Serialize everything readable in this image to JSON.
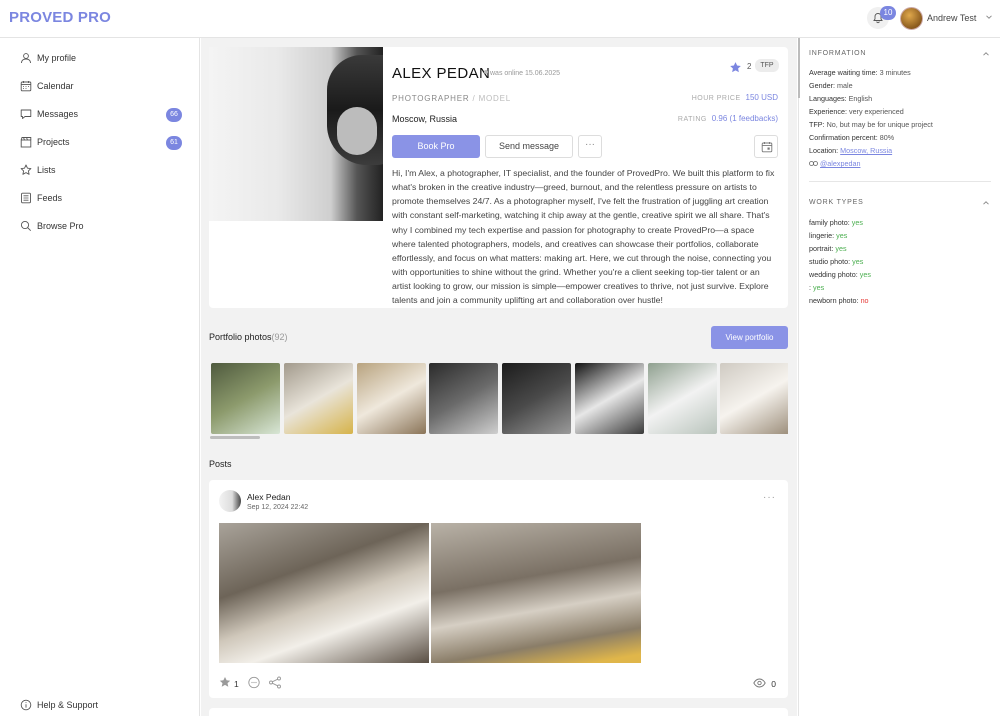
{
  "app": {
    "logo": "PROVED PRO"
  },
  "header": {
    "notification_count": "10",
    "user_name": "Andrew Test"
  },
  "sidebar": {
    "items": [
      {
        "label": "My profile",
        "icon": "user-icon"
      },
      {
        "label": "Calendar",
        "icon": "calendar-icon"
      },
      {
        "label": "Messages",
        "icon": "chat-icon",
        "badge": "66"
      },
      {
        "label": "Projects",
        "icon": "clapperboard-icon",
        "badge": "61"
      },
      {
        "label": "Lists",
        "icon": "star-icon"
      },
      {
        "label": "Feeds",
        "icon": "feed-icon"
      },
      {
        "label": "Browse Pro",
        "icon": "search-icon"
      }
    ],
    "help": "Help & Support"
  },
  "profile": {
    "name": "ALEX PEDAN",
    "online": "was online 15.06.2025",
    "star_count": "2",
    "tfp": "TFP",
    "role_primary": "PHOTOGRAPHER",
    "role_separator": "/",
    "role_secondary": "MODEL",
    "hour_price_label": "HOUR PRICE",
    "hour_price": "150 USD",
    "location": "Moscow, Russia",
    "rating_label": "RATING",
    "rating": "0.96 (1 feedbacks)",
    "book_label": "Book Pro",
    "message_label": "Send message",
    "more_label": "···",
    "bio": "Hi, I'm Alex, a photographer, IT specialist, and the founder of ProvedPro. We built this platform to fix what's broken in the creative industry—greed, burnout, and the relentless pressure on artists to promote themselves 24/7. As a photographer myself, I've felt the frustration of juggling art creation with constant self-marketing, watching it chip away at the gentle, creative spirit we all share. That's why I combined my tech expertise and passion for photography to create ProvedPro—a space where talented photographers, models, and creatives can showcase their portfolios, collaborate effortlessly, and focus on what matters: making art. Here, we cut through the noise, connecting you with opportunities to shine without the grind. Whether you're a client seeking top-tier talent or an artist looking to grow, our mission is simple—empower creatives to thrive, not just survive. Explore talents and join a community uplifting art and collaboration over hustle!"
  },
  "portfolio": {
    "title": "Portfolio photos",
    "count": "(92)",
    "button": "View portfolio",
    "thumb_colors": [
      [
        "#4f5a3e",
        "#8c9a6c",
        "#d8e6d6"
      ],
      [
        "#a29a8c",
        "#e9e4da",
        "#d6b34a"
      ],
      [
        "#b8a37f",
        "#efe8dc",
        "#8a7458"
      ],
      [
        "#2b2b2b",
        "#6a6a6a",
        "#cfcfcf"
      ],
      [
        "#1c1c1c",
        "#4a4a4a",
        "#9a9a9a"
      ],
      [
        "#121212",
        "#e7e7e7",
        "#3a3a3a"
      ],
      [
        "#8fa08f",
        "#f2f2f2",
        "#b9c4bc"
      ],
      [
        "#cfcac2",
        "#f6f3ee",
        "#9d8f7c"
      ]
    ]
  },
  "posts": {
    "title": "Posts",
    "items": [
      {
        "author": "Alex Pedan",
        "date": "Sep 12, 2024 22:42",
        "likes": "1",
        "views": "0"
      }
    ]
  },
  "info": {
    "title": "INFORMATION",
    "rows": [
      {
        "label": "Average waiting time:",
        "value": "3 minutes"
      },
      {
        "label": "Gender:",
        "value": "male"
      },
      {
        "label": "Languages:",
        "value": "English"
      },
      {
        "label": "Experience:",
        "value": "very experienced"
      },
      {
        "label": "TFP:",
        "value": "No, but may be for unique project"
      },
      {
        "label": "Confirmation percent:",
        "value": "80%"
      },
      {
        "label": "Location:",
        "value": "Moscow, Russia"
      }
    ],
    "link": "@alexpedan"
  },
  "work_types": {
    "title": "WORK TYPES",
    "rows": [
      {
        "label": "family photo:",
        "value": "yes"
      },
      {
        "label": "lingerie:",
        "value": "yes"
      },
      {
        "label": "portrait:",
        "value": "yes"
      },
      {
        "label": "studio photo:",
        "value": "yes"
      },
      {
        "label": "wedding photo:",
        "value": "yes"
      },
      {
        "label": ":",
        "value": "yes"
      },
      {
        "label": "newborn photo:",
        "value": "no"
      }
    ]
  },
  "colors": {
    "accent": "#7b86e0",
    "button": "#8a93e6",
    "yes": "#4caf50",
    "no": "#e53935"
  }
}
